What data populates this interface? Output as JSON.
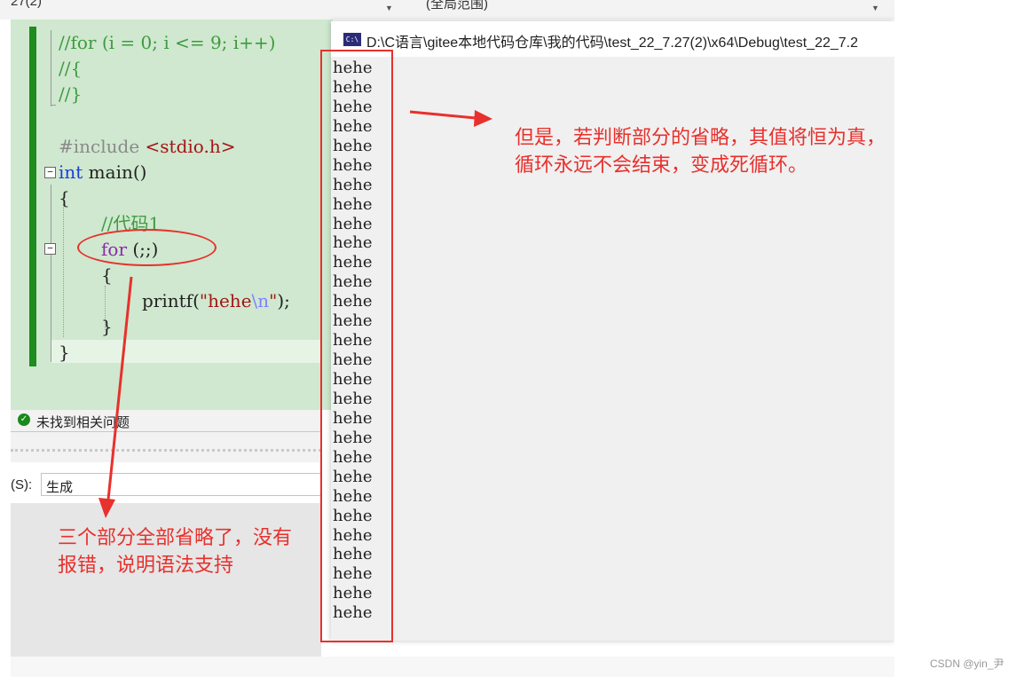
{
  "top_strip": {
    "left_text": "27(2)",
    "mid_text": "(全局范围)"
  },
  "editor": {
    "comment_for": "//for (i = 0; i <= 9; i++)",
    "comment_open": "//{",
    "comment_close": "//}",
    "include_kw": "#include",
    "include_hdr": "<stdio.h>",
    "int_kw": "int",
    "main_sig": " main()",
    "brace_open": "{",
    "code_comment": "//代码1",
    "for_kw": "for",
    "for_args": " (;;)",
    "for_brace_open": "{",
    "printf_name": "printf(",
    "str_open": "\"hehe",
    "str_escape": "\\n",
    "str_close": "\"",
    "printf_end": ");",
    "for_brace_close": "}",
    "brace_close": "}"
  },
  "status_bar": {
    "message": "未找到相关问题"
  },
  "output_panel": {
    "label": "(S):",
    "selected": "生成"
  },
  "console": {
    "icon": "C:\\",
    "title": "D:\\C语言\\gitee本地代码仓库\\我的代码\\test_22_7.27(2)\\x64\\Debug\\test_22_7.2",
    "lines": [
      "hehe",
      "hehe",
      "hehe",
      "hehe",
      "hehe",
      "hehe",
      "hehe",
      "hehe",
      "hehe",
      "hehe",
      "hehe",
      "hehe",
      "hehe",
      "hehe",
      "hehe",
      "hehe",
      "hehe",
      "hehe",
      "hehe",
      "hehe",
      "hehe",
      "hehe",
      "hehe",
      "hehe",
      "hehe",
      "hehe",
      "hehe",
      "hehe",
      "hehe"
    ]
  },
  "annotations": {
    "right_line1": "但是，若判断部分的省略，其值将恒为真，",
    "right_line2": "循环永远不会结束，变成死循环。",
    "left_line1": "三个部分全部省略了，没有",
    "left_line2": "报错，说明语法支持"
  },
  "watermark": "CSDN @yin_尹",
  "colors": {
    "annotation_red": "#e8302c",
    "editor_bg": "#cfe8cf",
    "change_bar": "#1e8c1e"
  }
}
